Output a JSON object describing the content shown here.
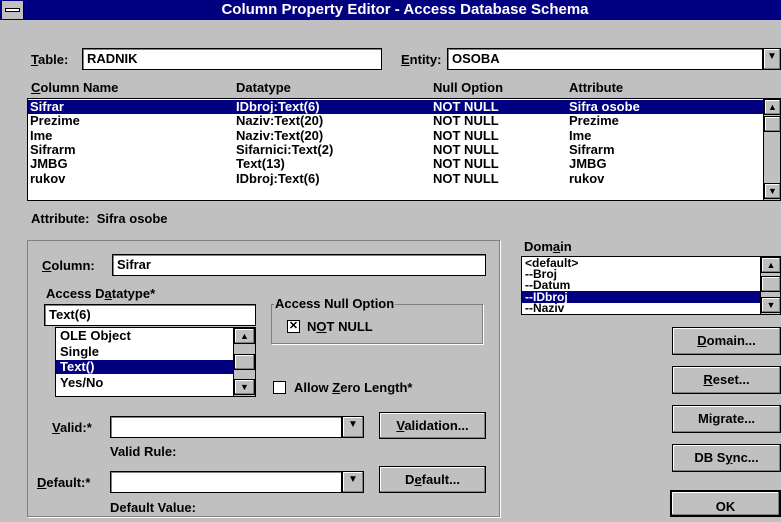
{
  "window": {
    "title": "Column Property Editor - Access Database Schema"
  },
  "table": {
    "label": "Table:",
    "value": "RADNIK"
  },
  "entity": {
    "label": "Entity:",
    "value": "OSOBA"
  },
  "columns_grid": {
    "headers": [
      "Column Name",
      "Datatype",
      "Null Option",
      "Attribute"
    ],
    "rows": [
      {
        "name": "Sifrar",
        "datatype": "IDbroj:Text(6)",
        "null": "NOT NULL",
        "attribute": "Sifra osobe"
      },
      {
        "name": "Prezime",
        "datatype": "Naziv:Text(20)",
        "null": "NOT NULL",
        "attribute": "Prezime"
      },
      {
        "name": "Ime",
        "datatype": "Naziv:Text(20)",
        "null": "NOT NULL",
        "attribute": "Ime"
      },
      {
        "name": "Sifrarm",
        "datatype": "Sifarnici:Text(2)",
        "null": "NOT NULL",
        "attribute": "Sifrarm"
      },
      {
        "name": "JMBG",
        "datatype": "Text(13)",
        "null": "NOT NULL",
        "attribute": "JMBG"
      },
      {
        "name": "rukov",
        "datatype": "IDbroj:Text(6)",
        "null": "NOT NULL",
        "attribute": "rukov"
      }
    ],
    "selected_index": 0
  },
  "attribute_line": {
    "label": "Attribute:",
    "value": "Sifra osobe"
  },
  "column": {
    "label": "Column:",
    "value": "Sifrar"
  },
  "access_datatype": {
    "label": "Access Datatype*",
    "value": "Text(6)",
    "options": [
      "OLE Object",
      "Single",
      "Text()",
      "Yes/No"
    ],
    "selected_index": 2
  },
  "null_option": {
    "group_label": "Access Null Option",
    "label": "NOT NULL",
    "checked": true
  },
  "allow_zero": {
    "label": "Allow Zero Length*",
    "checked": false
  },
  "valid": {
    "label": "Valid:*",
    "value": "",
    "sublabel": "Valid Rule:",
    "button": "Validation..."
  },
  "default": {
    "label": "Default:*",
    "value": "",
    "sublabel": "Default Value:",
    "button": "Default..."
  },
  "domain": {
    "label": "Domain",
    "items": [
      "<default>",
      "--Broj",
      "--Datum",
      "--IDbroj",
      "--Naziv"
    ],
    "selected_index": 3
  },
  "buttons": {
    "domain": "Domain...",
    "reset": "Reset...",
    "migrate": "Migrate...",
    "dbsync": "DB Sync...",
    "ok": "OK"
  },
  "icons": {
    "down": "▼",
    "up": "▲",
    "check": "✕"
  },
  "colors": {
    "selection": "#000080",
    "face": "#c0c0c0"
  }
}
